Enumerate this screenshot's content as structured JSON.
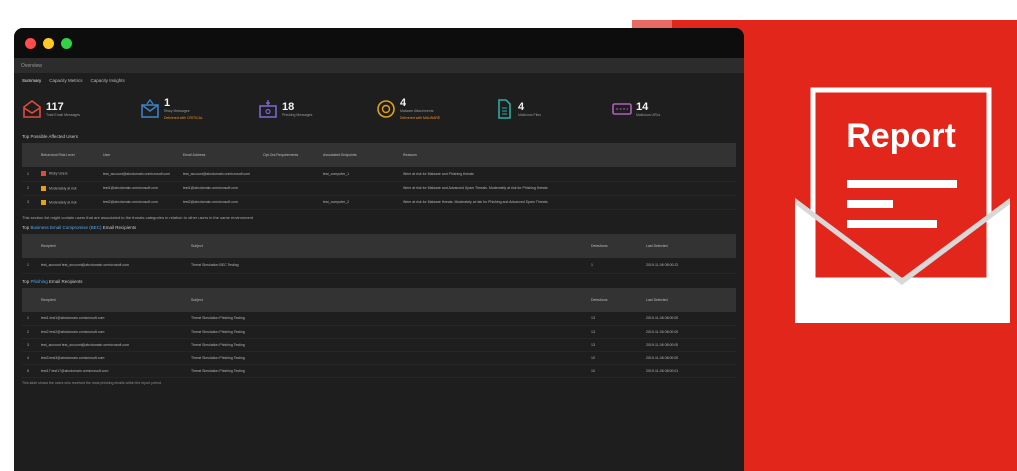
{
  "app": {
    "menu_label": "Overview"
  },
  "filters": [
    "Summary",
    "Capacity Metrics",
    "Capacity Insights"
  ],
  "stats": [
    {
      "value": "117",
      "label": "Total Email Messages",
      "icon": "email-stack-icon",
      "color": "#e24a3c",
      "warning": ""
    },
    {
      "value": "1",
      "label": "Risky Messages",
      "icon": "email-alert-icon",
      "color": "#3d7fc1",
      "warning": "Delivered with CRITICAL"
    },
    {
      "value": "18",
      "label": "Phishing Messages",
      "icon": "phishing-hook-icon",
      "color": "#7a64c9",
      "warning": ""
    },
    {
      "value": "4",
      "label": "Malware Attachments",
      "icon": "malware-icon",
      "color": "#e0a21c",
      "warning": "Delivered with MALWARE"
    },
    {
      "value": "4",
      "label": "Malicious Files",
      "icon": "file-icon",
      "color": "#2eaaa2",
      "warning": ""
    },
    {
      "value": "14",
      "label": "Malicious URLs",
      "icon": "link-icon",
      "color": "#b15fbf",
      "warning": ""
    }
  ],
  "section1": {
    "title": "Top Possible Affected Users",
    "columns": [
      "",
      "Behavioral Risk Level",
      "User",
      "Email Address",
      "Opt-Out Requirements",
      "Associated Endpoints",
      "Reasons"
    ],
    "rows": [
      {
        "index": "1",
        "severity_color": "#e24a3c",
        "risk": "Risky Users",
        "user": "test_account@abcdomain.onmicrosoft.com",
        "email": "test_account@abcdomain.onmicrosoft.com",
        "optout": "",
        "endpoints": "test_computer_1",
        "reasons": "Were at risk for Malware and Phishing threats"
      },
      {
        "index": "2",
        "severity_color": "#e0a21c",
        "risk": "Moderately at risk",
        "user": "test1@abcdomain.onmicrosoft.com",
        "email": "test1@abcdomain.onmicrosoft.com",
        "optout": "",
        "endpoints": "",
        "reasons": "Were at risk for Malware and Advanced Spam Threats. Moderately at risk for Phishing threats"
      },
      {
        "index": "3",
        "severity_color": "#e0a21c",
        "risk": "Moderately at risk",
        "user": "test2@abcdomain.onmicrosoft.com",
        "email": "test2@abcdomain.onmicrosoft.com",
        "optout": "",
        "endpoints": "test_computer_2",
        "reasons": "Were at risk for Malware threats. Moderately at risk for Phishing and Advanced Spam Threats"
      }
    ],
    "note": "This section list might contain users that are associated to the threats categories in relation to other users in the same environment"
  },
  "section2": {
    "title_prefix": "Top ",
    "title_link": "Business Email Compromise (BEC)",
    "title_suffix": " Email Recipients",
    "columns": [
      "",
      "Recipient",
      "Subject",
      "Detections",
      "Last Detected"
    ],
    "rows": [
      {
        "index": "1",
        "recipient": "test_account test_account@abcdomain.onmicrosoft.com",
        "subject": "Threat Simulation BEC Testing",
        "detections": "1",
        "last": "2019-11-06 08:00:22"
      }
    ]
  },
  "section3": {
    "title_prefix": "Top ",
    "title_link": "Phishing",
    "title_suffix": " Email Recipients",
    "columns": [
      "",
      "Recipient",
      "Subject",
      "Detections",
      "Last Detected"
    ],
    "rows": [
      {
        "index": "1",
        "recipient": "test1 test1@abcdomain.onmicrosoft.com",
        "subject": "Threat Simulation Phishing Testing",
        "detections": "13",
        "last": "2019-11-06 08:00:00"
      },
      {
        "index": "2",
        "recipient": "test2 test2@abcdomain.onmicrosoft.com",
        "subject": "Threat Simulation Phishing Testing",
        "detections": "13",
        "last": "2019-11-06 08:00:00"
      },
      {
        "index": "3",
        "recipient": "test_account test_account@abcdomain.onmicrosoft.com",
        "subject": "Threat Simulation Phishing Testing",
        "detections": "13",
        "last": "2019-11-06 08:00:00"
      },
      {
        "index": "4",
        "recipient": "test3 test3@abcdomain.onmicrosoft.com",
        "subject": "Threat Simulation Phishing Testing",
        "detections": "10",
        "last": "2019-11-06 08:00:00"
      },
      {
        "index": "5",
        "recipient": "test17 test17@abcdomain.onmicrosoft.com",
        "subject": "Threat Simulation Phishing Testing",
        "detections": "10",
        "last": "2019-11-06 08:00:01"
      }
    ],
    "footnote": "This table shows the users who received the most phishing emails within the report period"
  },
  "report": {
    "label": "Report",
    "bg_color": "#e3261c"
  }
}
